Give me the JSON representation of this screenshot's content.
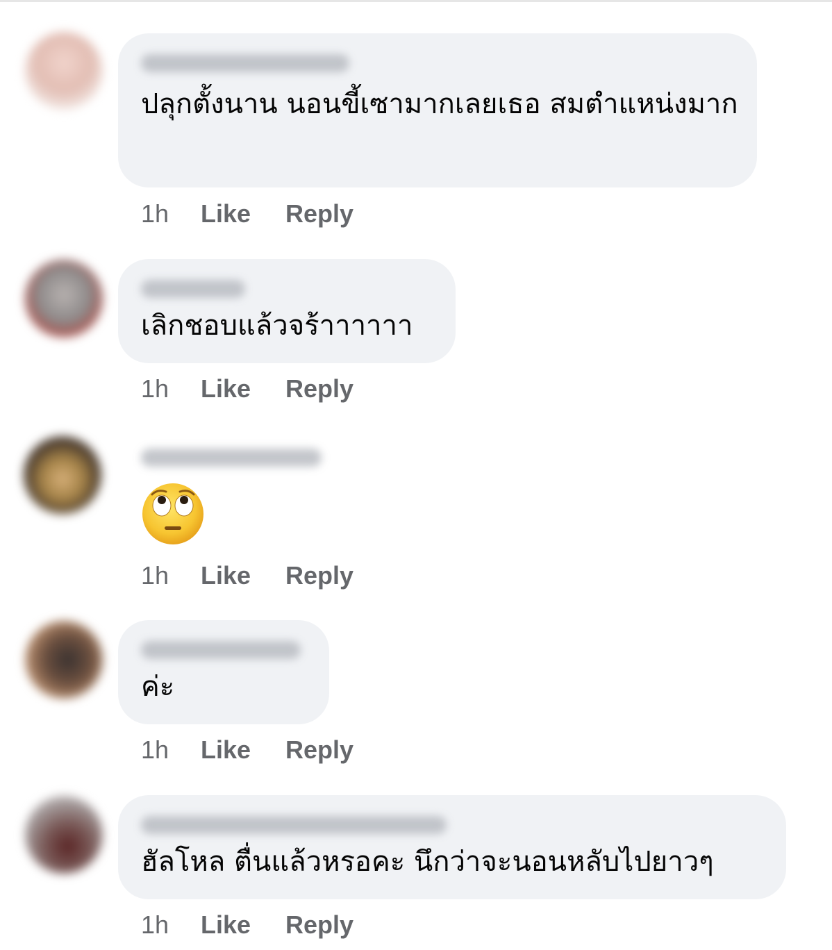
{
  "comments": [
    {
      "author": "",
      "text": "ปลุกตั้งนาน นอนขี้เซามากเลยเธอ สมตำแหน่งมาก",
      "time": "1h",
      "like": "Like",
      "reply": "Reply",
      "avatar_color": "#e8c9c0"
    },
    {
      "author": "",
      "text": "เลิกชอบแล้วจร้าาาาาา",
      "time": "1h",
      "like": "Like",
      "reply": "Reply",
      "avatar_color": "#8a8a8a"
    },
    {
      "author": "",
      "emoji": "face-with-rolling-eyes",
      "time": "1h",
      "like": "Like",
      "reply": "Reply",
      "avatar_color": "#6b5a3a"
    },
    {
      "author": "",
      "text": "ค่ะ",
      "time": "1h",
      "like": "Like",
      "reply": "Reply",
      "avatar_color": "#7a5a45"
    },
    {
      "author": "",
      "text": "ฮัลโหล ตื่นแล้วหรอคะ นึกว่าจะนอนหลับไปยาวๆ",
      "time": "1h",
      "like": "Like",
      "reply": "Reply",
      "avatar_color": "#6e5a5a"
    }
  ],
  "colors": {
    "bubble": "#f0f2f5",
    "text": "#050505",
    "meta": "#65676b"
  }
}
